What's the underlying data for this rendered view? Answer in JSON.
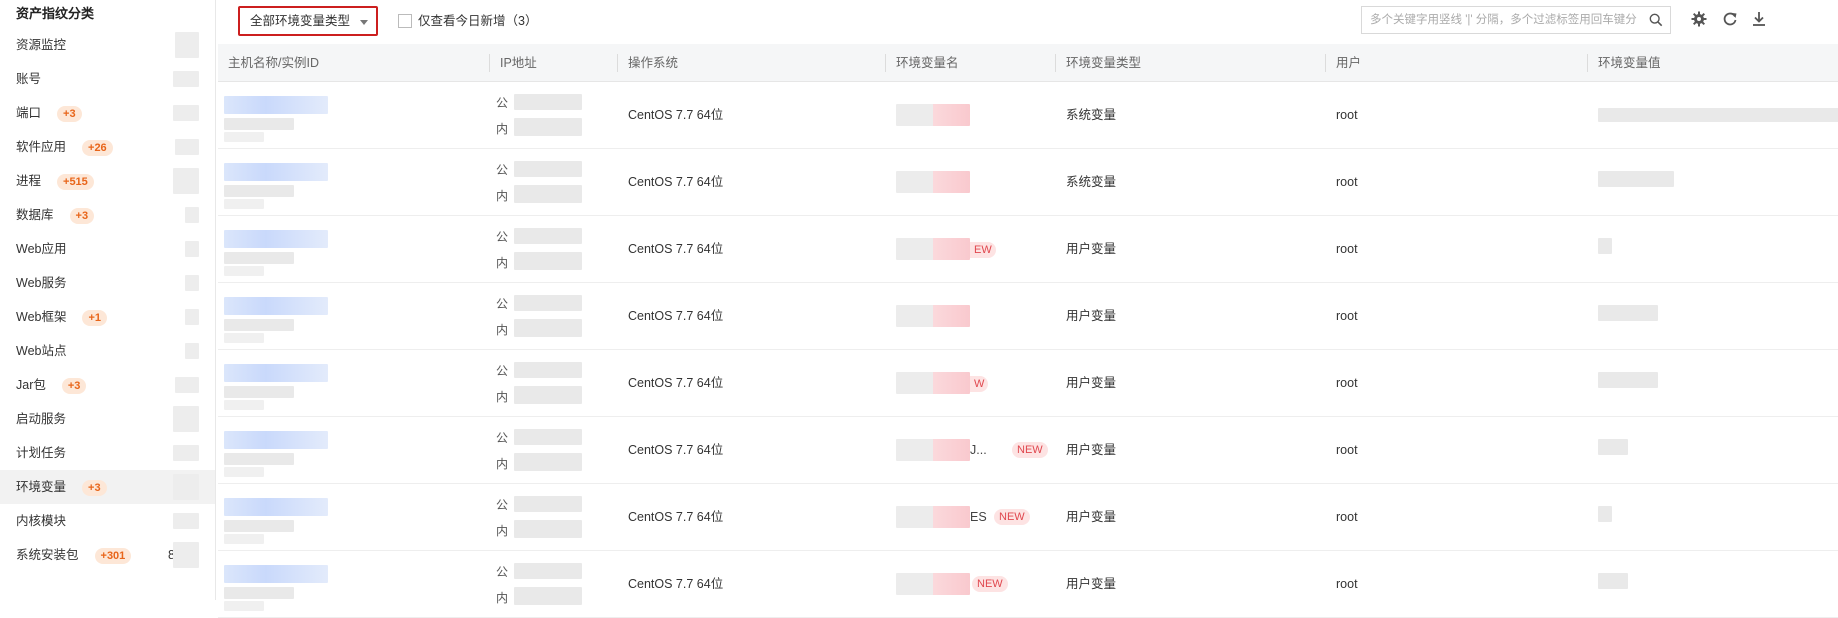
{
  "sidebar": {
    "title": "资产指纹分类",
    "items": [
      {
        "label": "资源监控",
        "badge": "",
        "active": false
      },
      {
        "label": "账号",
        "badge": "",
        "active": false
      },
      {
        "label": "端口",
        "badge": "+3",
        "active": false
      },
      {
        "label": "软件应用",
        "badge": "+26",
        "active": false
      },
      {
        "label": "进程",
        "badge": "+515",
        "active": false
      },
      {
        "label": "数据库",
        "badge": "+3",
        "active": false
      },
      {
        "label": "Web应用",
        "badge": "",
        "active": false
      },
      {
        "label": "Web服务",
        "badge": "",
        "active": false
      },
      {
        "label": "Web框架",
        "badge": "+1",
        "active": false
      },
      {
        "label": "Web站点",
        "badge": "",
        "active": false
      },
      {
        "label": "Jar包",
        "badge": "+3",
        "active": false
      },
      {
        "label": "启动服务",
        "badge": "",
        "active": false
      },
      {
        "label": "计划任务",
        "badge": "",
        "active": false
      },
      {
        "label": "环境变量",
        "badge": "+3",
        "active": true
      },
      {
        "label": "内核模块",
        "badge": "",
        "active": false
      },
      {
        "label": "系统安装包",
        "badge": "+301",
        "active": false,
        "trailing": "8"
      }
    ]
  },
  "toolbar": {
    "type_select": "全部环境变量类型",
    "today_only_label": "仅查看今日新增（3）",
    "search_placeholder": "多个关键字用竖线 '|' 分隔，多个过滤标签用回车键分隔",
    "icons": [
      "search-icon",
      "settings-icon",
      "refresh-icon",
      "download-icon"
    ]
  },
  "table": {
    "columns": [
      "主机名称/实例ID",
      "IP地址",
      "操作系统",
      "环境变量名",
      "环境变量类型",
      "用户",
      "环境变量值"
    ],
    "ip_public": "公",
    "ip_private": "内",
    "new_tag": "NEW",
    "rows": [
      {
        "os": "CentOS 7.7 64位",
        "var_type": "系统变量",
        "user": "root",
        "name_suffix": "",
        "new": false
      },
      {
        "os": "CentOS 7.7 64位",
        "var_type": "系统变量",
        "user": "root",
        "name_suffix": "",
        "new": false
      },
      {
        "os": "CentOS 7.7 64位",
        "var_type": "用户变量",
        "user": "root",
        "name_suffix": "EW",
        "new": false
      },
      {
        "os": "CentOS 7.7 64位",
        "var_type": "用户变量",
        "user": "root",
        "name_suffix": "",
        "new": false
      },
      {
        "os": "CentOS 7.7 64位",
        "var_type": "用户变量",
        "user": "root",
        "name_suffix": "W",
        "new": false
      },
      {
        "os": "CentOS 7.7 64位",
        "var_type": "用户变量",
        "user": "root",
        "name_suffix": "J...",
        "new": true
      },
      {
        "os": "CentOS 7.7 64位",
        "var_type": "用户变量",
        "user": "root",
        "name_suffix": "ES",
        "new": true
      },
      {
        "os": "CentOS 7.7 64位",
        "var_type": "用户变量",
        "user": "root",
        "name_suffix": "",
        "new": true
      }
    ]
  },
  "colors": {
    "highlight_border": "#cc1f1f",
    "badge_bg": "#fde7d7",
    "badge_text": "#e8651a",
    "new_bg": "#fde3e3",
    "new_text": "#e0484f"
  }
}
